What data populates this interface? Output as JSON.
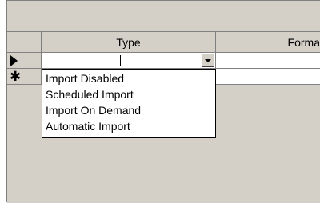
{
  "grid": {
    "columns": [
      {
        "label": "Type"
      },
      {
        "label": "Forma"
      }
    ],
    "row_selectors": {
      "current_icon": "triangle-right-icon",
      "new_icon": "asterisk-new-record-icon",
      "new_glyph": "✱"
    },
    "rows": [
      {
        "type": "",
        "format": ""
      },
      {
        "type": "",
        "format": ""
      }
    ]
  },
  "dropdown": {
    "options": [
      "Import Disabled",
      "Scheduled Import",
      "Import On Demand",
      "Automatic Import"
    ]
  },
  "colors": {
    "face": "#d4d0c8",
    "shadow": "#808080",
    "cell": "#ffffff",
    "text": "#000000"
  }
}
